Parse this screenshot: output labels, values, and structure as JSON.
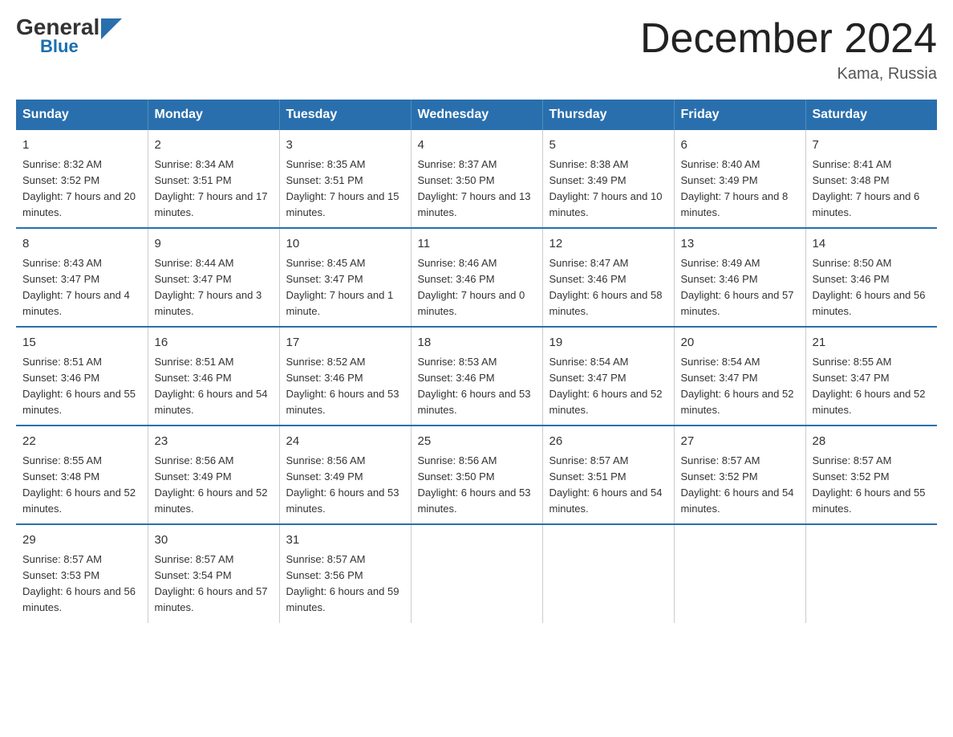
{
  "logo": {
    "general": "General",
    "triangle": "",
    "blue": "Blue"
  },
  "title": "December 2024",
  "location": "Kama, Russia",
  "weekdays": [
    "Sunday",
    "Monday",
    "Tuesday",
    "Wednesday",
    "Thursday",
    "Friday",
    "Saturday"
  ],
  "weeks": [
    [
      {
        "day": "1",
        "sunrise": "8:32 AM",
        "sunset": "3:52 PM",
        "daylight": "7 hours and 20 minutes."
      },
      {
        "day": "2",
        "sunrise": "8:34 AM",
        "sunset": "3:51 PM",
        "daylight": "7 hours and 17 minutes."
      },
      {
        "day": "3",
        "sunrise": "8:35 AM",
        "sunset": "3:51 PM",
        "daylight": "7 hours and 15 minutes."
      },
      {
        "day": "4",
        "sunrise": "8:37 AM",
        "sunset": "3:50 PM",
        "daylight": "7 hours and 13 minutes."
      },
      {
        "day": "5",
        "sunrise": "8:38 AM",
        "sunset": "3:49 PM",
        "daylight": "7 hours and 10 minutes."
      },
      {
        "day": "6",
        "sunrise": "8:40 AM",
        "sunset": "3:49 PM",
        "daylight": "7 hours and 8 minutes."
      },
      {
        "day": "7",
        "sunrise": "8:41 AM",
        "sunset": "3:48 PM",
        "daylight": "7 hours and 6 minutes."
      }
    ],
    [
      {
        "day": "8",
        "sunrise": "8:43 AM",
        "sunset": "3:47 PM",
        "daylight": "7 hours and 4 minutes."
      },
      {
        "day": "9",
        "sunrise": "8:44 AM",
        "sunset": "3:47 PM",
        "daylight": "7 hours and 3 minutes."
      },
      {
        "day": "10",
        "sunrise": "8:45 AM",
        "sunset": "3:47 PM",
        "daylight": "7 hours and 1 minute."
      },
      {
        "day": "11",
        "sunrise": "8:46 AM",
        "sunset": "3:46 PM",
        "daylight": "7 hours and 0 minutes."
      },
      {
        "day": "12",
        "sunrise": "8:47 AM",
        "sunset": "3:46 PM",
        "daylight": "6 hours and 58 minutes."
      },
      {
        "day": "13",
        "sunrise": "8:49 AM",
        "sunset": "3:46 PM",
        "daylight": "6 hours and 57 minutes."
      },
      {
        "day": "14",
        "sunrise": "8:50 AM",
        "sunset": "3:46 PM",
        "daylight": "6 hours and 56 minutes."
      }
    ],
    [
      {
        "day": "15",
        "sunrise": "8:51 AM",
        "sunset": "3:46 PM",
        "daylight": "6 hours and 55 minutes."
      },
      {
        "day": "16",
        "sunrise": "8:51 AM",
        "sunset": "3:46 PM",
        "daylight": "6 hours and 54 minutes."
      },
      {
        "day": "17",
        "sunrise": "8:52 AM",
        "sunset": "3:46 PM",
        "daylight": "6 hours and 53 minutes."
      },
      {
        "day": "18",
        "sunrise": "8:53 AM",
        "sunset": "3:46 PM",
        "daylight": "6 hours and 53 minutes."
      },
      {
        "day": "19",
        "sunrise": "8:54 AM",
        "sunset": "3:47 PM",
        "daylight": "6 hours and 52 minutes."
      },
      {
        "day": "20",
        "sunrise": "8:54 AM",
        "sunset": "3:47 PM",
        "daylight": "6 hours and 52 minutes."
      },
      {
        "day": "21",
        "sunrise": "8:55 AM",
        "sunset": "3:47 PM",
        "daylight": "6 hours and 52 minutes."
      }
    ],
    [
      {
        "day": "22",
        "sunrise": "8:55 AM",
        "sunset": "3:48 PM",
        "daylight": "6 hours and 52 minutes."
      },
      {
        "day": "23",
        "sunrise": "8:56 AM",
        "sunset": "3:49 PM",
        "daylight": "6 hours and 52 minutes."
      },
      {
        "day": "24",
        "sunrise": "8:56 AM",
        "sunset": "3:49 PM",
        "daylight": "6 hours and 53 minutes."
      },
      {
        "day": "25",
        "sunrise": "8:56 AM",
        "sunset": "3:50 PM",
        "daylight": "6 hours and 53 minutes."
      },
      {
        "day": "26",
        "sunrise": "8:57 AM",
        "sunset": "3:51 PM",
        "daylight": "6 hours and 54 minutes."
      },
      {
        "day": "27",
        "sunrise": "8:57 AM",
        "sunset": "3:52 PM",
        "daylight": "6 hours and 54 minutes."
      },
      {
        "day": "28",
        "sunrise": "8:57 AM",
        "sunset": "3:52 PM",
        "daylight": "6 hours and 55 minutes."
      }
    ],
    [
      {
        "day": "29",
        "sunrise": "8:57 AM",
        "sunset": "3:53 PM",
        "daylight": "6 hours and 56 minutes."
      },
      {
        "day": "30",
        "sunrise": "8:57 AM",
        "sunset": "3:54 PM",
        "daylight": "6 hours and 57 minutes."
      },
      {
        "day": "31",
        "sunrise": "8:57 AM",
        "sunset": "3:56 PM",
        "daylight": "6 hours and 59 minutes."
      },
      null,
      null,
      null,
      null
    ]
  ]
}
